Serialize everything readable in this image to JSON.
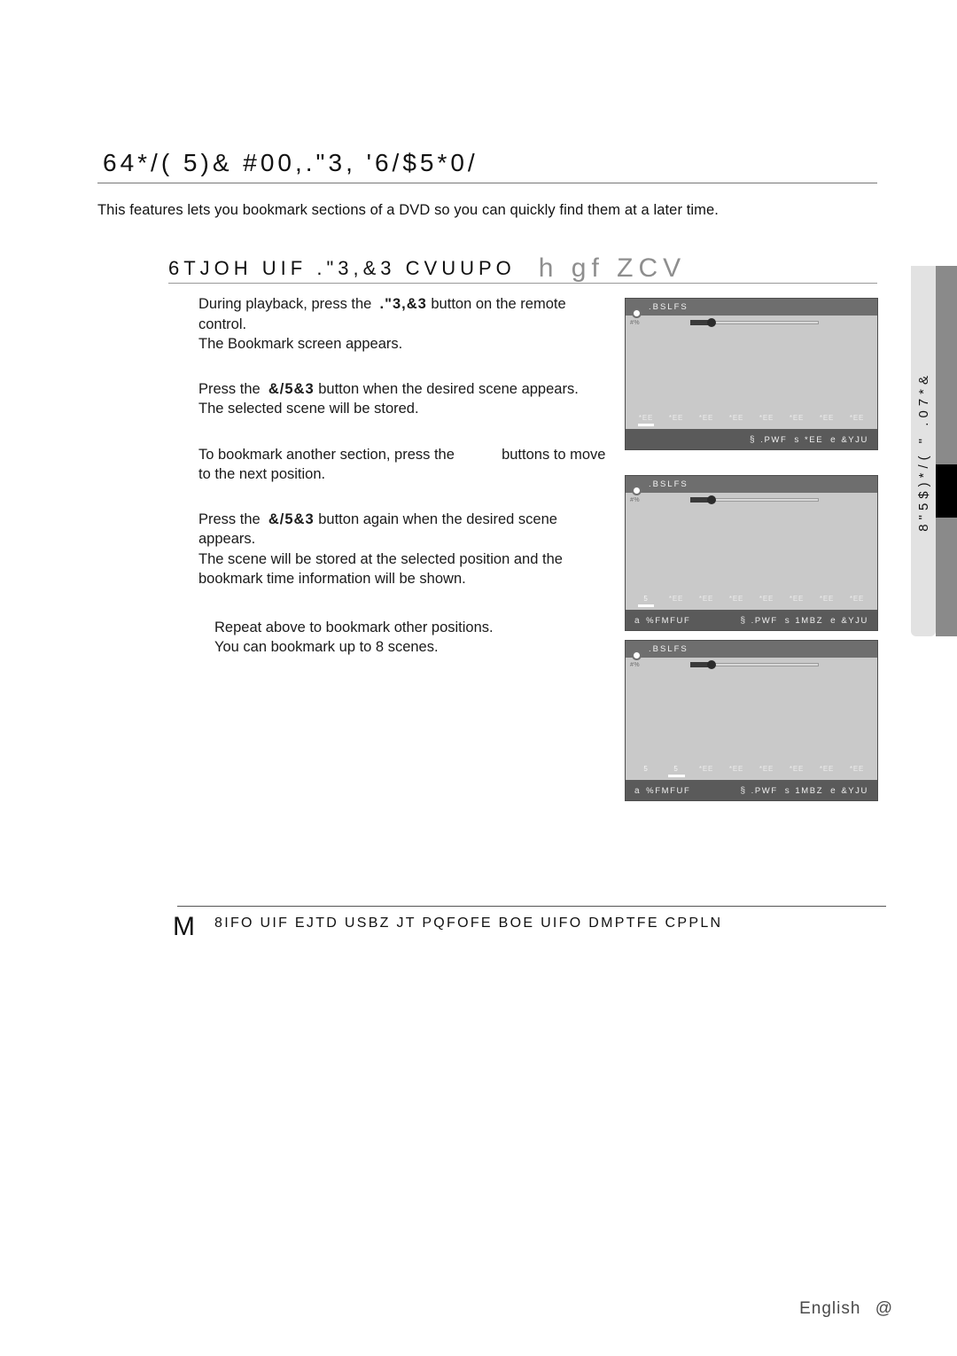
{
  "page": {
    "title": "64*/( 5)& #00,.\"3, '6/$5*0/",
    "intro": "This features lets you bookmark sections of a DVD so you can quickly find them at a later time."
  },
  "section": {
    "heading": "6TJOH UIF .\"3,&3 CVUUPO",
    "disc_icons": "h gf  ZCV"
  },
  "steps": [
    {
      "name": "step-press-marker",
      "lines": [
        {
          "pre": "During playback, press the  ",
          "kw": ".\"3,&3",
          "post": " button on the remote"
        },
        {
          "pre": "control.",
          "kw": "",
          "post": ""
        },
        {
          "pre": "The Bookmark screen appears.",
          "kw": "",
          "post": ""
        }
      ]
    },
    {
      "name": "step-press-enter",
      "lines": [
        {
          "pre": "Press the  ",
          "kw": "&/5&3",
          "post": " button when the desired scene appears."
        },
        {
          "pre": "The selected scene will be stored.",
          "kw": "",
          "post": ""
        }
      ]
    },
    {
      "name": "step-bookmark-another",
      "lines": [
        {
          "pre": "To bookmark another section, press the ",
          "kw": "",
          "gap": true,
          "post": " buttons to move"
        },
        {
          "pre": "to the next position.",
          "kw": "",
          "post": ""
        }
      ]
    },
    {
      "name": "step-press-enter-again",
      "lines": [
        {
          "pre": "Press the  ",
          "kw": "&/5&3",
          "post": " button again when the desired scene"
        },
        {
          "pre": "appears.",
          "kw": "",
          "post": ""
        },
        {
          "pre": "The scene will be stored at the selected position and the",
          "kw": "",
          "post": ""
        },
        {
          "pre": "bookmark time information will be shown.",
          "kw": "",
          "post": ""
        }
      ]
    }
  ],
  "step_note": {
    "line1": "Repeat above to bookmark other positions.",
    "line2": "You can bookmark up to 8 scenes."
  },
  "osd_screens": [
    {
      "name": "osd-marker-empty",
      "title": ".BSLFS",
      "disc_label": "#%",
      "progress_percent": 16,
      "slots": [
        "*EE",
        "*EE",
        "*EE",
        "*EE",
        "*EE",
        "*EE",
        "*EE",
        "*EE"
      ],
      "cursor_slot": 0,
      "status_left": "",
      "status_left_key": "",
      "status_items": [
        {
          "key": "§",
          "label": ".PWF"
        },
        {
          "key": "s",
          "label": "*EE"
        },
        {
          "key": "e",
          "label": "&YJU"
        }
      ]
    },
    {
      "name": "osd-marker-one-stored",
      "title": ".BSLFS",
      "disc_label": "#%",
      "progress_percent": 16,
      "slots": [
        "5",
        "*EE",
        "*EE",
        "*EE",
        "*EE",
        "*EE",
        "*EE",
        "*EE"
      ],
      "cursor_slot": 0,
      "status_left": "%FMFUF",
      "status_left_key": "a",
      "status_items": [
        {
          "key": "§",
          "label": ".PWF"
        },
        {
          "key": "s",
          "label": "1MBZ"
        },
        {
          "key": "e",
          "label": "&YJU"
        }
      ]
    },
    {
      "name": "osd-marker-two-stored",
      "title": ".BSLFS",
      "disc_label": "#%",
      "progress_percent": 16,
      "slots": [
        "5",
        "5",
        "*EE",
        "*EE",
        "*EE",
        "*EE",
        "*EE",
        "*EE"
      ],
      "cursor_slot": 1,
      "status_left": "%FMFUF",
      "status_left_key": "a",
      "status_items": [
        {
          "key": "§",
          "label": ".PWF"
        },
        {
          "key": "s",
          "label": "1MBZ"
        },
        {
          "key": "e",
          "label": "&YJU"
        }
      ]
    }
  ],
  "side_tab": {
    "label": "8\"5$)*/( \" .07*&"
  },
  "note": {
    "icon": "M",
    "text": "8IFO UIF EJTD USBZ JT PQFOFE BOE UIFO DMPTFE  CPPLN"
  },
  "footer": {
    "language": "English",
    "page_number": "@"
  }
}
